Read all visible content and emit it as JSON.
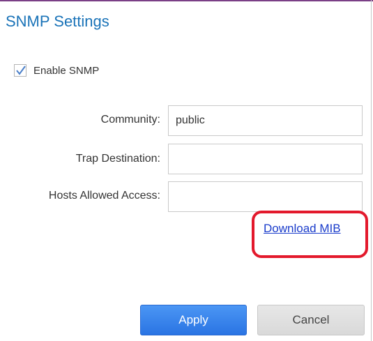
{
  "dialog": {
    "title": "SNMP Settings"
  },
  "enable_snmp": {
    "label": "Enable SNMP",
    "checked": true
  },
  "fields": {
    "community": {
      "label": "Community:",
      "value": "public"
    },
    "trap_destination": {
      "label": "Trap Destination:",
      "value": ""
    },
    "hosts_allowed_access": {
      "label": "Hosts Allowed Access:",
      "value": ""
    }
  },
  "links": {
    "download_mib": "Download MIB"
  },
  "buttons": {
    "apply": "Apply",
    "cancel": "Cancel"
  },
  "colors": {
    "title": "#1a73b8",
    "link": "#1a3ccb",
    "highlight": "#e3192c",
    "apply_button": "#3a84ec"
  },
  "icons": {
    "check": "check-icon"
  }
}
